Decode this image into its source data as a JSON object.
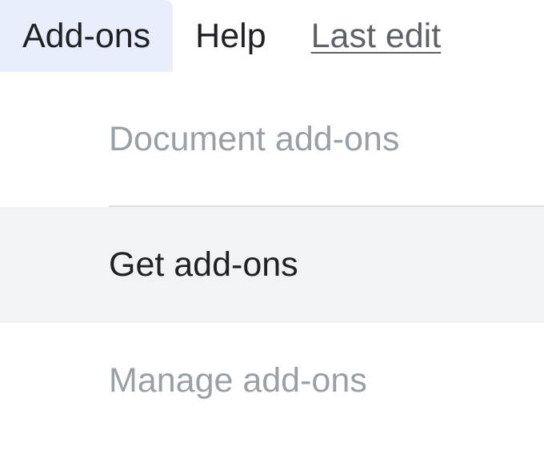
{
  "menubar": {
    "addons": "Add-ons",
    "help": "Help",
    "last_edit": "Last edit"
  },
  "dropdown": {
    "section_header": "Document add-ons",
    "get_addons": "Get add-ons",
    "manage_addons": "Manage add-ons"
  }
}
